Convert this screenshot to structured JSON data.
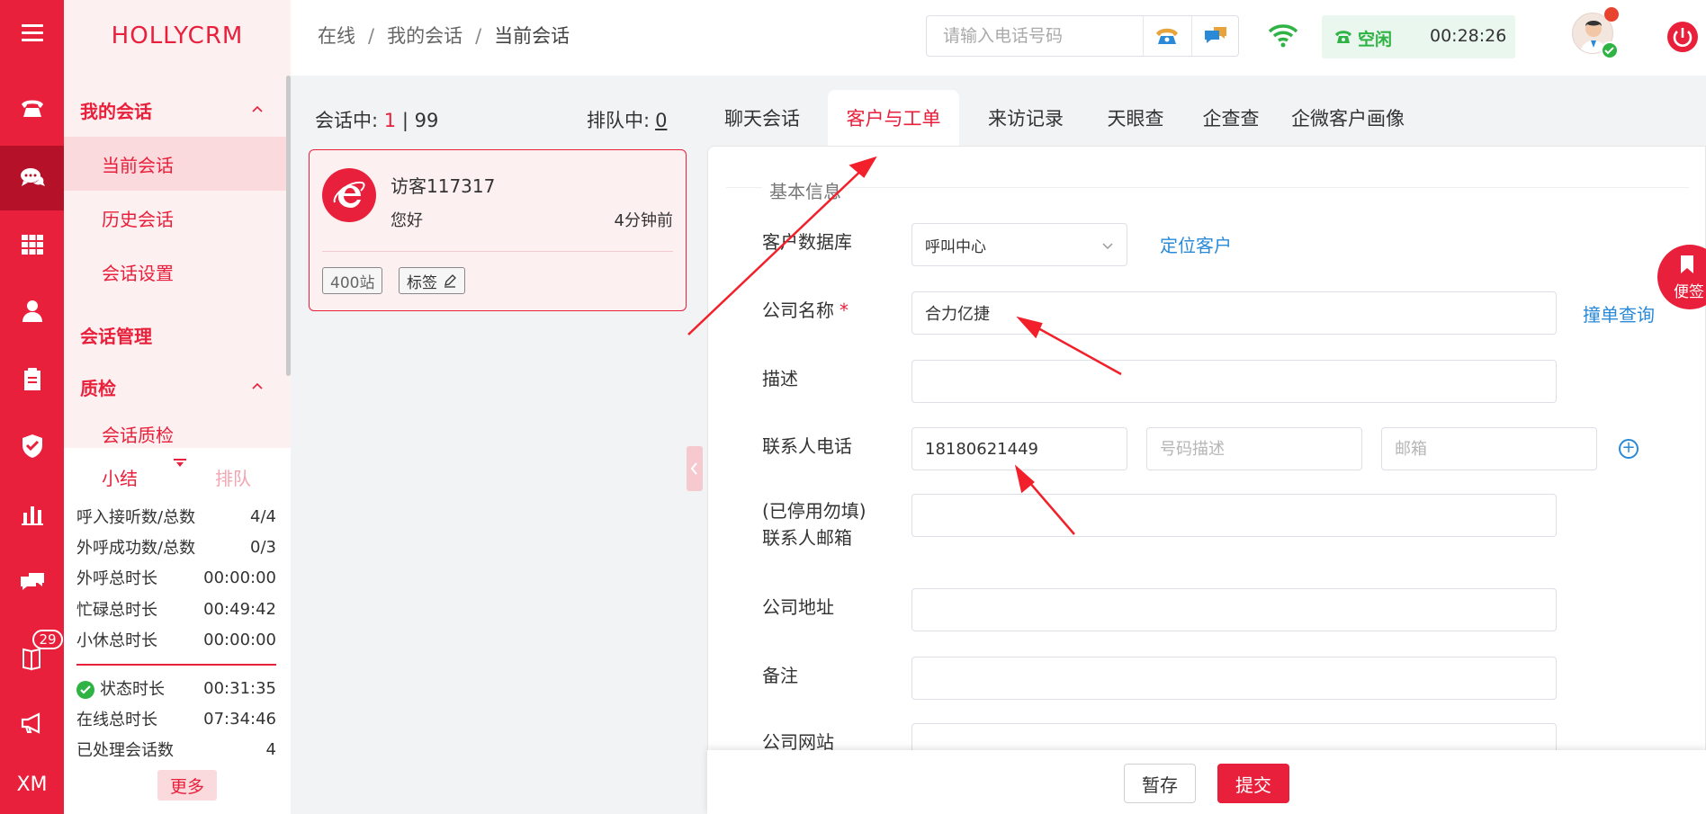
{
  "app": {
    "logo": "HOLLYCRM"
  },
  "rail": {
    "badge_count": "29",
    "bottom_label": "XM"
  },
  "menu": {
    "group_my_sessions": "我的会话",
    "current_session": "当前会话",
    "history_session": "历史会话",
    "session_settings": "会话设置",
    "group_session_mgmt": "会话管理",
    "group_quality": "质检",
    "session_quality": "会话质检"
  },
  "stats": {
    "tab_summary": "小结",
    "tab_queue": "排队",
    "rows": [
      {
        "label": "呼入接听数/总数",
        "value": "4/4"
      },
      {
        "label": "外呼成功数/总数",
        "value": "0/3"
      },
      {
        "label": "外呼总时长",
        "value": "00:00:00"
      },
      {
        "label": "忙碌总时长",
        "value": "00:49:42"
      },
      {
        "label": "小休总时长",
        "value": "00:00:00"
      }
    ],
    "rows2": [
      {
        "label": "状态时长",
        "value": "00:31:35"
      },
      {
        "label": "在线总时长",
        "value": "07:34:46"
      },
      {
        "label": "已处理会话数",
        "value": "4"
      }
    ],
    "more": "更多"
  },
  "header": {
    "breadcrumb": [
      "在线",
      "我的会话",
      "当前会话"
    ],
    "phone_placeholder": "请输入电话号码",
    "status_label": "空闲",
    "timer": "00:28:26"
  },
  "session_list": {
    "in_session_label": "会话中:",
    "in_session_count": "1",
    "in_session_sep": "|",
    "in_session_total": "99",
    "queue_label": "排队中:",
    "queue_count": "0",
    "card": {
      "visitor": "访客117317",
      "message": "您好",
      "time": "4分钟前",
      "tag_site": "400站",
      "tag_label": "标签"
    }
  },
  "tabs": [
    "聊天会话",
    "客户与工单",
    "来访记录",
    "天眼查",
    "企查查",
    "企微客户画像"
  ],
  "form": {
    "section": "基本信息",
    "db_label": "客户数据库",
    "db_value": "呼叫中心",
    "locate_link": "定位客户",
    "company_label": "公司名称",
    "company_required": "*",
    "company_value": "合力亿捷",
    "dup_link": "撞单查询",
    "desc_label": "描述",
    "desc_value": "",
    "phone_label": "联系人电话",
    "phone_value": "18180621449",
    "phone_desc_placeholder": "号码描述",
    "email_placeholder": "邮箱",
    "old_email_label_1": "(已停用勿填)",
    "old_email_label_2": "联系人邮箱",
    "address_label": "公司地址",
    "remark_label": "备注",
    "website_label": "公司网站"
  },
  "actions": {
    "save": "暂存",
    "submit": "提交"
  },
  "float_note": {
    "label": "便签"
  },
  "colors": {
    "brand": "#e8203b",
    "link": "#2a8ad8",
    "success": "#2fb344"
  }
}
